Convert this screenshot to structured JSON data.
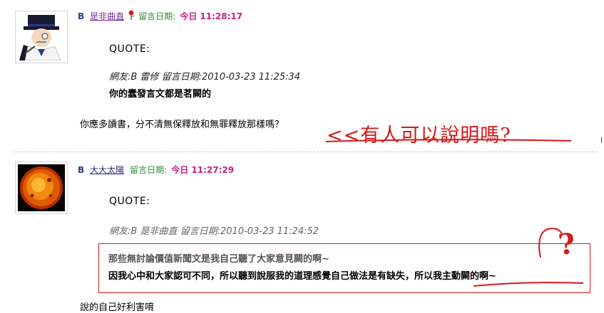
{
  "posts": [
    {
      "author_letter": "B",
      "username": "是非曲直",
      "date_label": "留言日期:",
      "date_value": "今日 11:28:17",
      "quote_label": "QUOTE:",
      "quoted_meta": "網友:B 雷修 留言日期:2010-03-23 11:25:34",
      "quoted_text": "你的蠢發言文都是茗闕的",
      "reply_text": "你應多讀書，分不清無保釋放和無罪釋放那樣嗎？",
      "annotation": "<<有人可以說明嗎?"
    },
    {
      "author_letter": "B",
      "username": "大大太陽",
      "date_label": "留言日期:",
      "date_value": "今日 11:27:29",
      "quote_label": "QUOTE:",
      "quoted_meta": "網友:B 是非曲直 留言日期:2010-03-23 11:24:52",
      "highlight_line_1": "那些無討論價值新聞文是我自己聽了大家意見闕的啊~",
      "highlight_line_2": "因我心中和大家認可不同，所以聽到說服我的道理感覺自己做法是有缺失，所以我主動闕的啊~",
      "reply_text": "說的自己好利害唷",
      "annotation": "?"
    }
  ],
  "side_marker": "I",
  "colors": {
    "username_purple": "#7b2a9b",
    "date_label_green": "#2e8b2e",
    "time_magenta": "#c81e8a",
    "annotation_red": "#d61818"
  }
}
